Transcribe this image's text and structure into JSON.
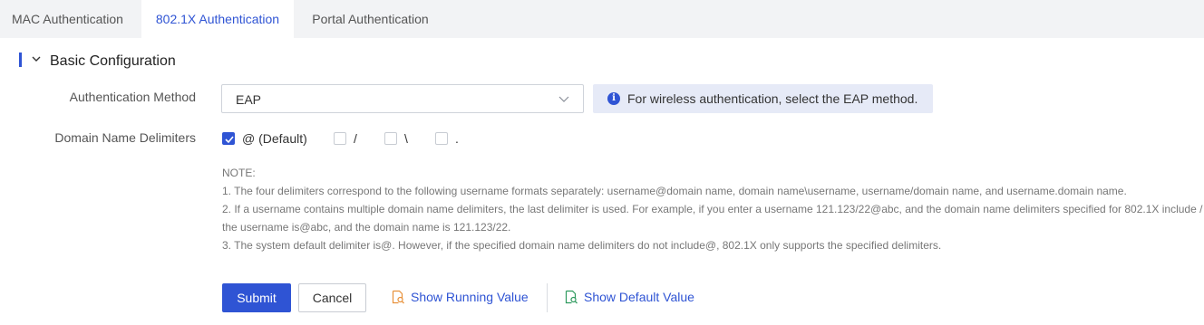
{
  "tabs": {
    "mac": "MAC Authentication",
    "dot1x": "802.1X Authentication",
    "portal": "Portal Authentication",
    "active": "802.1X Authentication"
  },
  "section": {
    "title": "Basic Configuration",
    "expanded": true
  },
  "auth_method": {
    "label": "Authentication Method",
    "value": "EAP",
    "info": "For wireless authentication, select the EAP method."
  },
  "domain_delimiters": {
    "label": "Domain Name Delimiters",
    "options": [
      {
        "label": "@ (Default)",
        "checked": true
      },
      {
        "label": "/",
        "checked": false
      },
      {
        "label": "\\",
        "checked": false
      },
      {
        "label": ".",
        "checked": false
      }
    ]
  },
  "note": {
    "heading": "NOTE:",
    "lines": [
      "1. The four delimiters correspond to the following username formats separately: username@domain name, domain name\\username, username/domain name, and username.domain name.",
      "2. If a username contains multiple domain name delimiters, the last delimiter is used. For example, if you enter a username 121.123/22@abc, and the domain name delimiters specified for 802.1X include /",
      "the username is@abc, and the domain name is 121.123/22.",
      "3. The system default delimiter is@. However, if the specified domain name delimiters do not include@, 802.1X only supports the specified delimiters."
    ]
  },
  "actions": {
    "submit": "Submit",
    "cancel": "Cancel",
    "show_running": "Show Running Value",
    "show_default": "Show Default Value"
  },
  "colors": {
    "accent": "#2f54d4",
    "info_bg": "#e6eaf7",
    "tabbar_bg": "#f2f3f5",
    "running_icon": "#e8913a",
    "default_icon": "#2e9a5e"
  }
}
